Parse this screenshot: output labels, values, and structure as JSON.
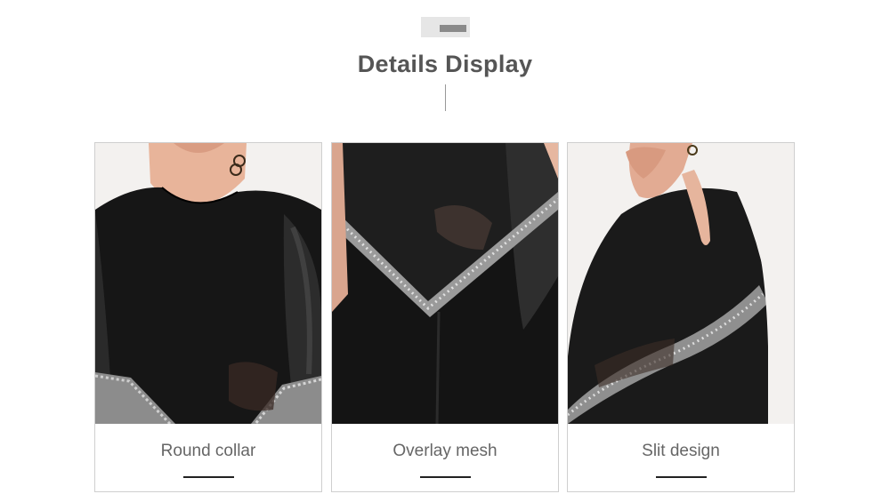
{
  "header": {
    "title": "Details Display"
  },
  "cards": [
    {
      "caption": "Round collar",
      "image": "round-collar-photo"
    },
    {
      "caption": "Overlay mesh",
      "image": "overlay-mesh-photo"
    },
    {
      "caption": "Slit design",
      "image": "slit-design-photo"
    }
  ],
  "colors": {
    "title": "#555555",
    "caption": "#666666",
    "underline": "#222222",
    "card_border": "#cfcfcf",
    "badge": "#e6e6e6"
  }
}
